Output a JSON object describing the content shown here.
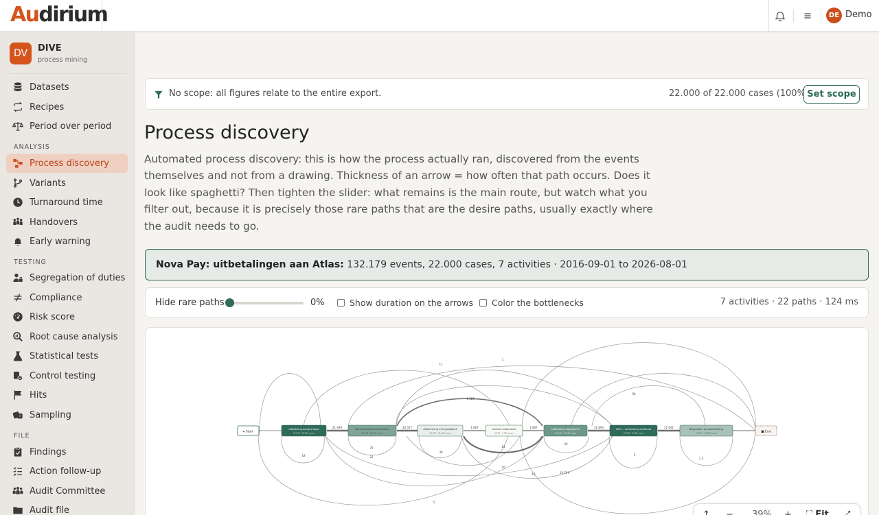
{
  "header": {
    "logo_first": "Au",
    "logo_rest": "dirium",
    "user_initials": "DE",
    "user_name": "Demo",
    "icons": [
      "bell-icon",
      "menu-icon"
    ]
  },
  "sidebar": {
    "org_initials": "DV",
    "org_name": "DIVE",
    "org_sub": "process mining",
    "items_top": [
      {
        "label": "Datasets",
        "icon": "database-icon"
      },
      {
        "label": "Recipes",
        "icon": "repeat-icon"
      },
      {
        "label": "Period over period",
        "icon": "scale-icon"
      }
    ],
    "analysis_title": "ANALYSIS",
    "analysis": [
      {
        "label": "Process discovery",
        "icon": "process-icon",
        "active": true
      },
      {
        "label": "Variants",
        "icon": "branch-icon"
      },
      {
        "label": "Turnaround time",
        "icon": "clock-icon"
      },
      {
        "label": "Handovers",
        "icon": "people-icon"
      },
      {
        "label": "Early warning",
        "icon": "bell-icon"
      }
    ],
    "testing_title": "TESTING",
    "testing": [
      {
        "label": "Segregation of duties",
        "icon": "user-lock-icon"
      },
      {
        "label": "Compliance",
        "icon": "not-equal-icon"
      },
      {
        "label": "Risk score",
        "icon": "gauge-icon"
      },
      {
        "label": "Root cause analysis",
        "icon": "search-icon"
      },
      {
        "label": "Statistical tests",
        "icon": "flask-icon"
      },
      {
        "label": "Control testing",
        "icon": "shield-check-icon"
      },
      {
        "label": "Hits",
        "icon": "flag-icon"
      },
      {
        "label": "Sampling",
        "icon": "dice-icon"
      }
    ],
    "file_title": "FILE",
    "file": [
      {
        "label": "Findings",
        "icon": "clipboard-icon"
      },
      {
        "label": "Action follow-up",
        "icon": "list-check-icon"
      },
      {
        "label": "Audit Committee",
        "icon": "group-icon"
      },
      {
        "label": "Audit file",
        "icon": "folder-icon"
      }
    ]
  },
  "scope": {
    "text": "No scope: all figures relate to the entire export.",
    "count": "22.000 of 22.000 cases (100%)",
    "button": "Set scope"
  },
  "page": {
    "title": "Process discovery",
    "intro": "Automated process discovery: this is how the process actually ran, discovered from the events themselves and not from a drawing. Thickness of an arrow = how often that path occurs. Does it look like spaghetti? Then tighten the slider: what remains is the main route, but watch what you filter out, because it is precisely those rare paths that are the desire paths, usually exactly where the audit needs to go."
  },
  "dataset": {
    "name": "Nova Pay: uitbetalingen aan Atlas:",
    "summary": "132.179 events, 22.000 cases, 7 activities · 2016-09-01 to 2026-08-01"
  },
  "controls": {
    "rare_label": "Hide rare paths",
    "rare_value": "0%",
    "rare_fraction": 0,
    "duration_label": "Show duration on the arrows",
    "bottleneck_label": "Color the bottlenecks",
    "stats": "7 activities · 22 paths · 124 ms"
  },
  "graph": {
    "start_label": "▸ Start",
    "end_label": "■ End",
    "nodes": [
      {
        "label": "Uitbetaling aangevraagd",
        "sub": "22.000 · 22.000 cases",
        "fill": "#2f6b5a",
        "text": "#ffffff"
      },
      {
        "label": "Transactiedatum aanmaken",
        "sub": "22.043 · 22.040 cases",
        "fill": "#7fa597",
        "text": "#1f3a31"
      },
      {
        "label": "Afstemming met grootboek",
        "sub": "21.872 · 21.670 cases",
        "fill": "#e8eeeb",
        "text": "#333333"
      },
      {
        "label": "Verschil onderzocht",
        "sub": "1.807 · 1.790 cases",
        "fill": "#f7f7f3",
        "text": "#333333"
      },
      {
        "label": "Uitbetaling uitgegeven",
        "sub": "21.945 · 21.930 cases",
        "fill": "#6e9888",
        "text": "#ffffff"
      },
      {
        "label": "2074 - verbonding verdound",
        "sub": "21.892 · 21.80 cases",
        "fill": "#2f6b5a",
        "text": "#ffffff"
      },
      {
        "label": "Bijgesloten op boekdrading",
        "sub": "21.801 · 21.800 cases",
        "fill": "#a8c2b8",
        "text": "#1f3a31"
      }
    ],
    "edge_labels": [
      "21.949",
      "20.557",
      "1.807",
      "1.807",
      "21.893",
      "21.641",
      "1",
      "17",
      "1.326",
      "58",
      "20",
      "79",
      "18",
      "38",
      "19.759",
      "2",
      "18",
      "10",
      "5",
      "22",
      "24",
      "2.3"
    ]
  },
  "zoom": {
    "zoom_value": "39%",
    "fit_label": "Fit"
  }
}
